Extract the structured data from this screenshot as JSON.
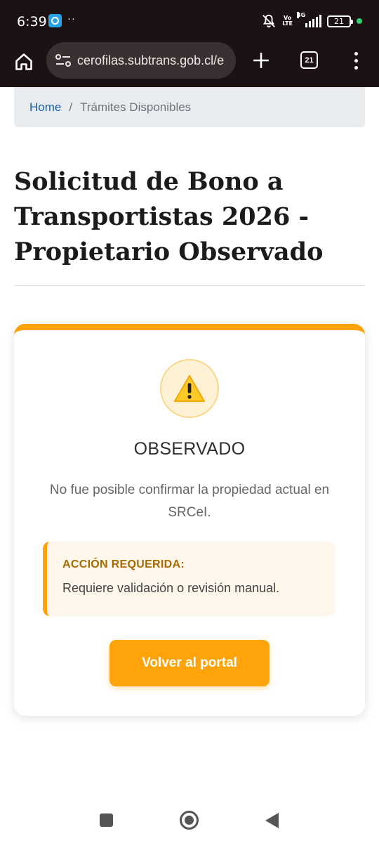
{
  "status_bar": {
    "time": "6:39",
    "dots": "··",
    "volte": "Vo\nLTE",
    "network": "4G",
    "battery": "21"
  },
  "browser": {
    "url": "cerofilas.subtrans.gob.cl/e",
    "tab_count": "21"
  },
  "breadcrumb": {
    "home": "Home",
    "separator": "/",
    "current": "Trámites Disponibles"
  },
  "page": {
    "title": "Solicitud de Bono a Transportistas 2026 - Propietario Observado"
  },
  "result_card": {
    "status": "OBSERVADO",
    "message": "No fue posible confirmar la propiedad actual en SRCeI.",
    "action_label": "ACCIÓN REQUERIDA:",
    "action_text": "Requiere validación o revisión manual.",
    "button_label": "Volver al portal",
    "accent_color": "#fea40a"
  },
  "icons": [
    "home-icon",
    "site-settings-icon",
    "plus-icon",
    "tabs-icon",
    "more-icon",
    "warning-icon",
    "bell-off-icon"
  ]
}
